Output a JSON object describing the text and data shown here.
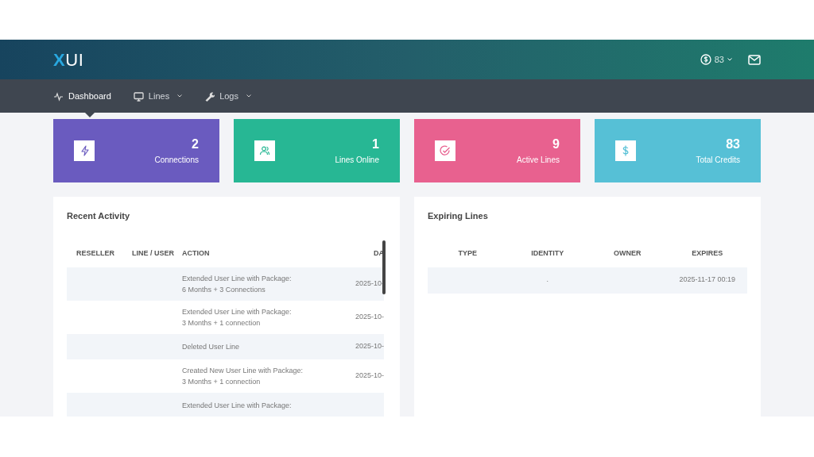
{
  "header": {
    "logo_mark": "X",
    "logo_rest": "UI",
    "credits": "83"
  },
  "nav": [
    {
      "label": "Dashboard",
      "dropdown": false,
      "selected": true
    },
    {
      "label": "Lines",
      "dropdown": true,
      "selected": false
    },
    {
      "label": "Logs",
      "dropdown": true,
      "selected": false
    }
  ],
  "stats": [
    {
      "value": "2",
      "label": "Connections",
      "color": "#6a5bbf"
    },
    {
      "value": "1",
      "label": "Lines Online",
      "color": "#27b794"
    },
    {
      "value": "9",
      "label": "Active Lines",
      "color": "#e8618f"
    },
    {
      "value": "83",
      "label": "Total Credits",
      "color": "#56c0d6"
    }
  ],
  "recent_activity": {
    "title": "Recent Activity",
    "columns": [
      "RESELLER",
      "LINE / USER",
      "ACTION",
      "DA"
    ],
    "rows": [
      {
        "reseller": "",
        "line_user": "",
        "action": [
          "Extended User Line with Package:",
          "6 Months + 3 Connections"
        ],
        "date": "2025-10-"
      },
      {
        "reseller": "",
        "line_user": "",
        "action": [
          "Extended User Line with Package:",
          "3 Months + 1 connection"
        ],
        "date": "2025-10-"
      },
      {
        "reseller": "",
        "line_user": "",
        "action": [
          "Deleted User Line"
        ],
        "date": "2025-10-"
      },
      {
        "reseller": "",
        "line_user": "",
        "action": [
          "Created New User Line with Package:",
          "3 Months + 1 connection"
        ],
        "date": "2025-10-"
      },
      {
        "reseller": "",
        "line_user": "",
        "action": [
          "Extended User Line with Package:"
        ],
        "date": ""
      }
    ]
  },
  "expiring_lines": {
    "title": "Expiring Lines",
    "columns": [
      "TYPE",
      "IDENTITY",
      "OWNER",
      "EXPIRES"
    ],
    "rows": [
      {
        "type": "",
        "identity": ".",
        "owner": "",
        "expires": "2025-11-17 00:19"
      }
    ]
  }
}
